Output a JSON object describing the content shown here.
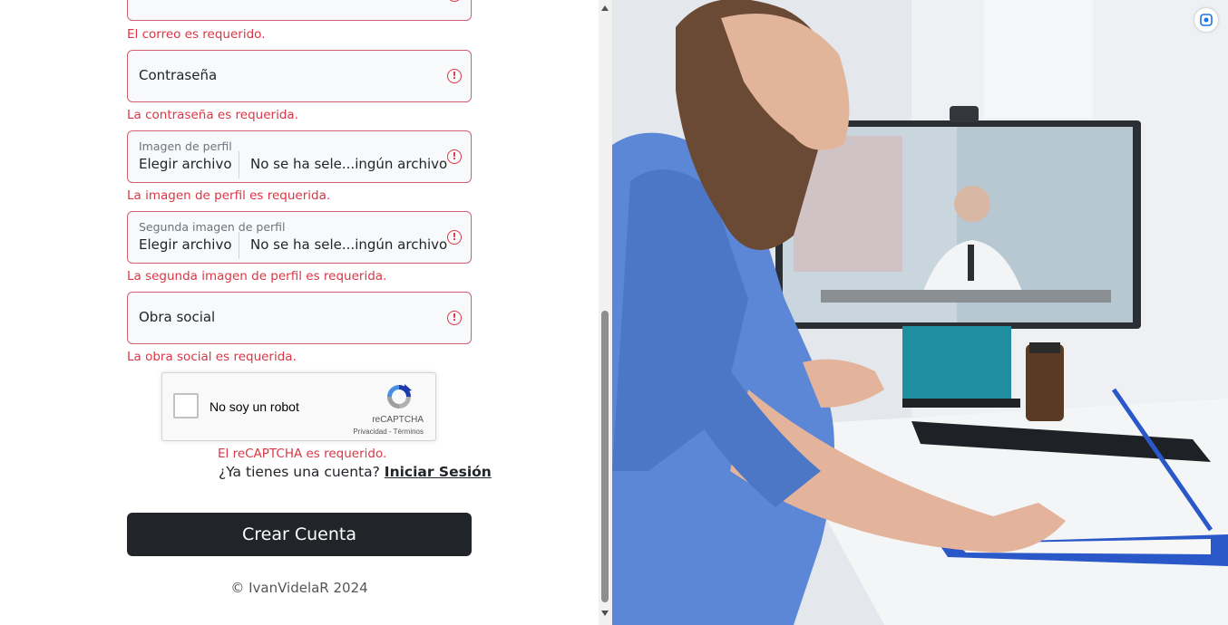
{
  "form": {
    "email_error": "El correo es requerido.",
    "password_placeholder": "Contraseña",
    "password_error": "La contraseña es requerida.",
    "profile_image": {
      "label": "Imagen de perfil",
      "choose": "Elegir archivo",
      "no_file": "No se ha sele...ingún archivo",
      "error": "La imagen de perfil es requerida."
    },
    "second_profile_image": {
      "label": "Segunda imagen de perfil",
      "choose": "Elegir archivo",
      "no_file": "No se ha sele...ingún archivo",
      "error": "La segunda imagen de perfil es requerida."
    },
    "insurance_placeholder": "Obra social",
    "insurance_error": "La obra social es requerida.",
    "alert_symbol": "!"
  },
  "recaptcha": {
    "label": "No soy un robot",
    "brand": "reCAPTCHA",
    "links": "Privacidad - Términos",
    "error": "El reCAPTCHA es requerido."
  },
  "account": {
    "question": "¿Ya tienes una cuenta?",
    "login_link": "Iniciar Sesión"
  },
  "submit_label": "Crear Cuenta",
  "footer": "© IvanVidelaR 2024",
  "colors": {
    "error": "#dc3545",
    "button": "#212529",
    "field_bg": "#f8f9fa"
  },
  "icons": {
    "field_alert": "exclamation-circle-icon",
    "lens": "google-lens-icon"
  }
}
